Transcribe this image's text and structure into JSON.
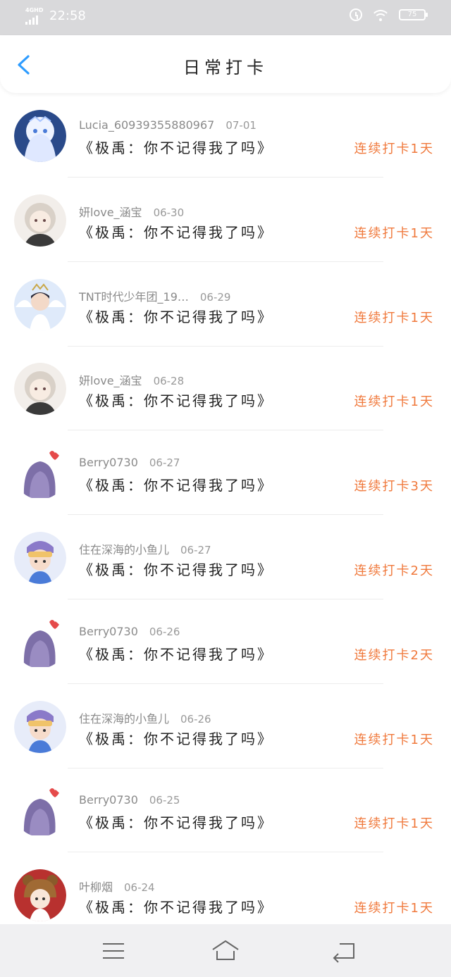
{
  "status_bar": {
    "network": "4GHD",
    "time": "22:58",
    "battery": "75"
  },
  "header": {
    "title": "日常打卡"
  },
  "colors": {
    "accent_orange": "#f0793c",
    "back_blue": "#2d9cff"
  },
  "entries": [
    {
      "name": "Lucia_60939355880967",
      "date": "07-01",
      "book": "《极禹：你不记得我了吗》",
      "streak": "连续打卡1天",
      "avatar": "avatar-white-hair-girl"
    },
    {
      "name": "妍love_涵宝",
      "date": "06-30",
      "book": "《极禹：你不记得我了吗》",
      "streak": "连续打卡1天",
      "avatar": "avatar-silver-hair-boy"
    },
    {
      "name": "TNT时代少年团_19…",
      "date": "06-29",
      "book": "《极禹：你不记得我了吗》",
      "streak": "连续打卡1天",
      "avatar": "avatar-angel-boy"
    },
    {
      "name": "妍love_涵宝",
      "date": "06-28",
      "book": "《极禹：你不记得我了吗》",
      "streak": "连续打卡1天",
      "avatar": "avatar-silver-hair-boy"
    },
    {
      "name": "Berry0730",
      "date": "06-27",
      "book": "《极禹：你不记得我了吗》",
      "streak": "连续打卡3天",
      "avatar": "avatar-purple-hair-girl"
    },
    {
      "name": "住在深海的小鱼儿",
      "date": "06-27",
      "book": "《极禹：你不记得我了吗》",
      "streak": "连续打卡2天",
      "avatar": "avatar-chibi-boy"
    },
    {
      "name": "Berry0730",
      "date": "06-26",
      "book": "《极禹：你不记得我了吗》",
      "streak": "连续打卡2天",
      "avatar": "avatar-purple-hair-girl"
    },
    {
      "name": "住在深海的小鱼儿",
      "date": "06-26",
      "book": "《极禹：你不记得我了吗》",
      "streak": "连续打卡1天",
      "avatar": "avatar-chibi-boy"
    },
    {
      "name": "Berry0730",
      "date": "06-25",
      "book": "《极禹：你不记得我了吗》",
      "streak": "连续打卡1天",
      "avatar": "avatar-purple-hair-girl"
    },
    {
      "name": "叶柳烟",
      "date": "06-24",
      "book": "《极禹：你不记得我了吗》",
      "streak": "连续打卡1天",
      "avatar": "avatar-bear-hat-girl"
    }
  ],
  "nav": {
    "menu": "menu-icon",
    "home": "home-icon",
    "back": "back-icon"
  }
}
